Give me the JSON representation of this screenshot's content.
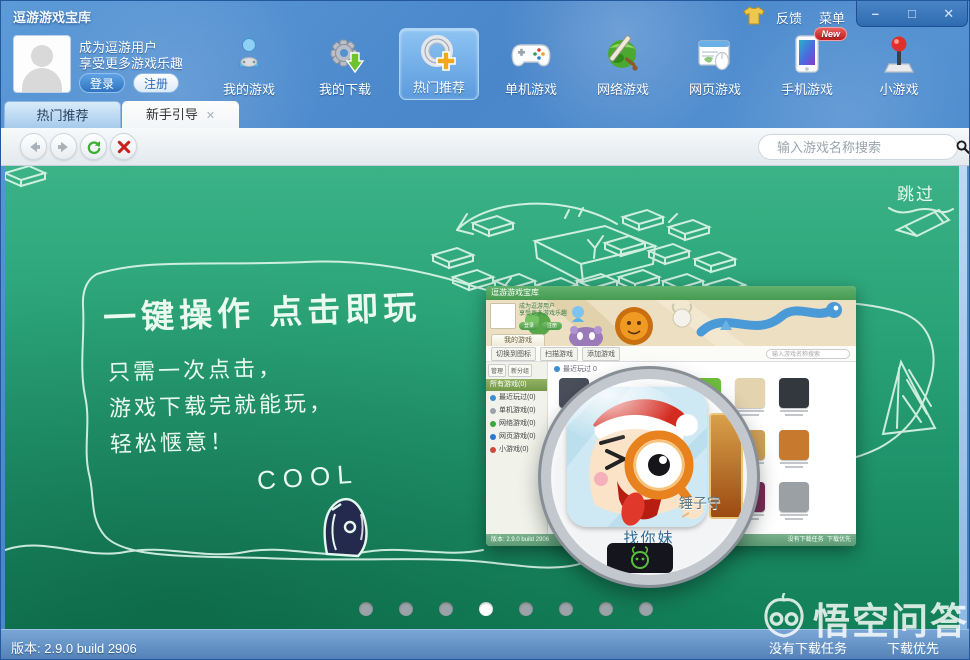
{
  "colors": {
    "accent_blue": "#4583c6",
    "stage_green": "#2aa378",
    "chalk": "#eafaf1",
    "active_tab_bg": "#f6f8f9",
    "status_blue": "#517fb5",
    "badge_red": "#c01818"
  },
  "window": {
    "title": "逗游游戏宝库",
    "feedback": "反馈",
    "menu": "菜单",
    "minimize": "–",
    "maximize": "□",
    "close": "✕"
  },
  "user_panel": {
    "line1": "成为逗游用户",
    "line2": "享受更多游戏乐趣",
    "login": "登录",
    "register": "注册"
  },
  "nav": {
    "items": [
      {
        "label": "我的游戏"
      },
      {
        "label": "我的下载"
      },
      {
        "label": "热门推荐",
        "active": true
      },
      {
        "label": "单机游戏"
      },
      {
        "label": "网络游戏"
      },
      {
        "label": "网页游戏"
      },
      {
        "label": "手机游戏",
        "badge": "New"
      },
      {
        "label": "小游戏"
      }
    ]
  },
  "tabs": [
    {
      "label": "热门推荐",
      "active": false
    },
    {
      "label": "新手引导",
      "active": true,
      "close": "✕"
    }
  ],
  "toolbar": {
    "search_placeholder": "输入游戏名称搜索"
  },
  "guide": {
    "skip": "跳过",
    "headline": "一键操作 点击即玩",
    "lines": [
      "只需一次点击，",
      "游戏下载完就能玩，",
      "轻松惬意！"
    ],
    "cool": "COOL",
    "magnified_game": "找你妹",
    "partial_game_label": "锤子守",
    "dots_total": 8,
    "dots_active_index": 3
  },
  "mini_app": {
    "title": "逗游游戏宝库",
    "user_line1": "成为逗游用户",
    "user_line2": "享受更多游戏乐趣",
    "login": "登录",
    "register": "注册",
    "tab": "我的游戏",
    "toolbar": [
      "切换到图标",
      "扫描游戏",
      "添加游戏"
    ],
    "search_placeholder": "输入游戏名称搜索",
    "sidebar_buttons": [
      "管理",
      "新分组"
    ],
    "sidebar_group": "所有游戏(0)",
    "sidebar_items": [
      "最近玩过(0)",
      "单机游戏(0)",
      "网络游戏(0)",
      "网页游戏(0)",
      "小游戏(0)"
    ],
    "sidebar_icon_colors": [
      "#3a8fd0",
      "#9aa2aa",
      "#3aa83a",
      "#2a7ad0",
      "#d04a3a"
    ],
    "section_header": "最近玩过 0",
    "game_icon_rows": [
      [
        "#4a4f5c",
        "#9e3b22",
        "#d8821f",
        "#6fbf3f",
        "#e3d3ae",
        "#33383f",
        "#8e1d12"
      ],
      [
        "#223c68",
        "#d8d0bf",
        "#cfe9f4",
        "#b35a1a",
        "#cfa05a",
        "#c77a2e",
        "#d8c9a8"
      ],
      [
        "#e0d8c8",
        "#b0b6ba",
        "#2a2a32",
        "#6abf4a",
        "#7a2e5a",
        "#9aa0a4",
        "#d0d0d0"
      ]
    ],
    "status_left": "版本: 2.9.0 build 2906",
    "status_right1": "没有下载任务",
    "status_right2": "下载优先"
  },
  "statusbar": {
    "version": "版本: 2.9.0 build 2906",
    "no_tasks": "没有下载任务",
    "priority": "下载优先"
  },
  "watermark": "悟空问答"
}
